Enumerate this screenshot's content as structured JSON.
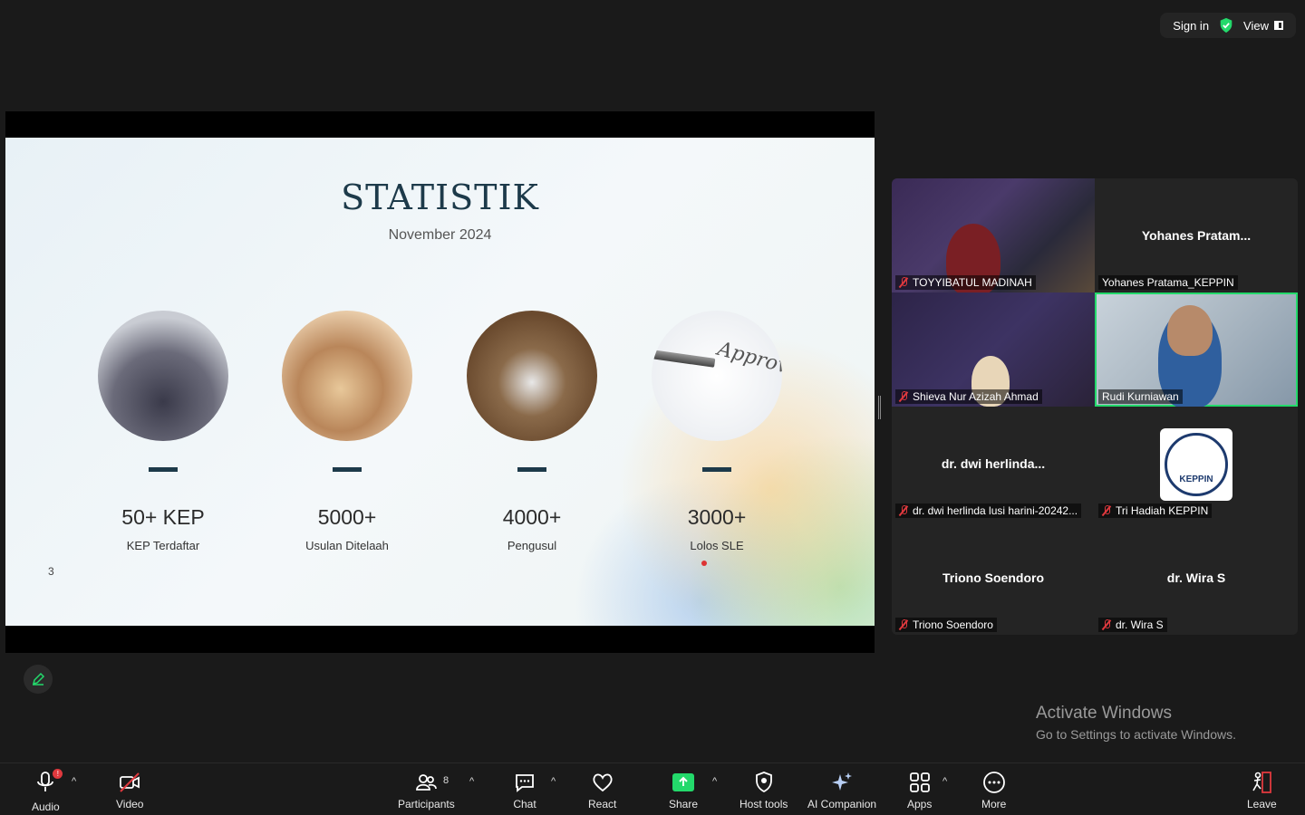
{
  "topbar": {
    "signin": "Sign in",
    "view": "View"
  },
  "slide": {
    "title": "STATISTIK",
    "subtitle": "November 2024",
    "page_number": "3",
    "stats": [
      {
        "value": "50+ KEP",
        "label": "KEP Terdaftar"
      },
      {
        "value": "5000+",
        "label": "Usulan Ditelaah"
      },
      {
        "value": "4000+",
        "label": "Pengusul"
      },
      {
        "value": "3000+",
        "label": "Lolos SLE"
      }
    ],
    "approve_text": "Approv"
  },
  "participants": [
    {
      "center": "",
      "name": "TOYYIBATUL MADINAH"
    },
    {
      "center": "Yohanes  Pratam...",
      "name": "Yohanes Pratama_KEPPIN"
    },
    {
      "center": "",
      "name": "Shieva Nur Azizah Ahmad"
    },
    {
      "center": "",
      "name": "Rudi Kurniawan"
    },
    {
      "center": "dr.  dwi  herlinda...",
      "name": "dr. dwi herlinda lusi harini-20242..."
    },
    {
      "center": "",
      "name": "Tri Hadiah KEPPIN"
    },
    {
      "center": "Triono Soendoro",
      "name": "Triono Soendoro"
    },
    {
      "center": "dr. Wira S",
      "name": "dr. Wira S"
    }
  ],
  "keppin_logo_text": "KEPPIN",
  "activate": {
    "line1": "Activate Windows",
    "line2": "Go to Settings to activate Windows."
  },
  "toolbar": {
    "audio": "Audio",
    "video": "Video",
    "participants": "Participants",
    "participants_count": "8",
    "chat": "Chat",
    "react": "React",
    "share": "Share",
    "host_tools": "Host tools",
    "ai_companion": "AI Companion",
    "apps": "Apps",
    "more": "More",
    "leave": "Leave"
  },
  "colors": {
    "active_speaker": "#23d96b",
    "muted": "#e0393e",
    "share": "#23d96b"
  }
}
